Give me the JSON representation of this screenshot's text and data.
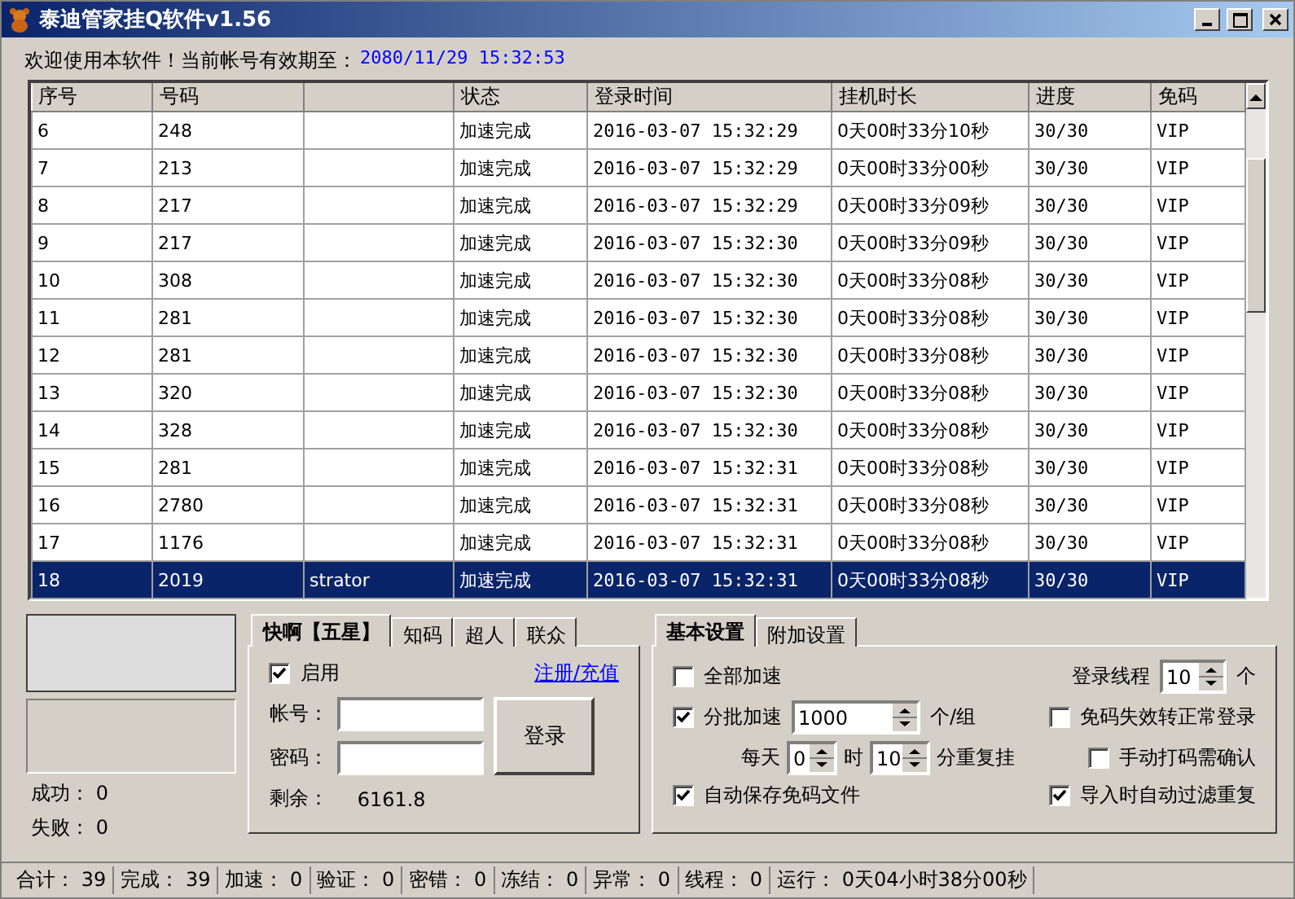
{
  "window": {
    "title": "泰迪管家挂Q软件v1.56"
  },
  "header": {
    "welcome": "欢迎使用本软件！当前帐号有效期至：",
    "expiry": "2080/11/29 15:32:53"
  },
  "table": {
    "columns": [
      "序号",
      "号码",
      "",
      "状态",
      "登录时间",
      "挂机时长",
      "进度",
      "免码"
    ],
    "rows": [
      {
        "cells": [
          "6",
          "248",
          "",
          "加速完成",
          "2016-03-07 15:32:29",
          "0天00时33分10秒",
          "30/30",
          "VIP"
        ],
        "selected": false
      },
      {
        "cells": [
          "7",
          "213",
          "",
          "加速完成",
          "2016-03-07 15:32:29",
          "0天00时33分00秒",
          "30/30",
          "VIP"
        ],
        "selected": false
      },
      {
        "cells": [
          "8",
          "217",
          "",
          "加速完成",
          "2016-03-07 15:32:29",
          "0天00时33分09秒",
          "30/30",
          "VIP"
        ],
        "selected": false
      },
      {
        "cells": [
          "9",
          "217",
          "",
          "加速完成",
          "2016-03-07 15:32:30",
          "0天00时33分09秒",
          "30/30",
          "VIP"
        ],
        "selected": false
      },
      {
        "cells": [
          "10",
          "308",
          "",
          "加速完成",
          "2016-03-07 15:32:30",
          "0天00时33分08秒",
          "30/30",
          "VIP"
        ],
        "selected": false
      },
      {
        "cells": [
          "11",
          "281",
          "",
          "加速完成",
          "2016-03-07 15:32:30",
          "0天00时33分08秒",
          "30/30",
          "VIP"
        ],
        "selected": false
      },
      {
        "cells": [
          "12",
          "281",
          "",
          "加速完成",
          "2016-03-07 15:32:30",
          "0天00时33分08秒",
          "30/30",
          "VIP"
        ],
        "selected": false
      },
      {
        "cells": [
          "13",
          "320",
          "",
          "加速完成",
          "2016-03-07 15:32:30",
          "0天00时33分08秒",
          "30/30",
          "VIP"
        ],
        "selected": false
      },
      {
        "cells": [
          "14",
          "328",
          "",
          "加速完成",
          "2016-03-07 15:32:30",
          "0天00时33分08秒",
          "30/30",
          "VIP"
        ],
        "selected": false
      },
      {
        "cells": [
          "15",
          "281",
          "",
          "加速完成",
          "2016-03-07 15:32:31",
          "0天00时33分08秒",
          "30/30",
          "VIP"
        ],
        "selected": false
      },
      {
        "cells": [
          "16",
          "2780",
          "",
          "加速完成",
          "2016-03-07 15:32:31",
          "0天00时33分08秒",
          "30/30",
          "VIP"
        ],
        "selected": false
      },
      {
        "cells": [
          "17",
          "1176",
          "",
          "加速完成",
          "2016-03-07 15:32:31",
          "0天00时33分08秒",
          "30/30",
          "VIP"
        ],
        "selected": false
      },
      {
        "cells": [
          "18",
          "2019",
          "strator",
          "加速完成",
          "2016-03-07 15:32:31",
          "0天00时33分08秒",
          "30/30",
          "VIP"
        ],
        "selected": true
      }
    ]
  },
  "results": [
    {
      "label": "成功：",
      "value": "0"
    },
    {
      "label": "失败：",
      "value": "0"
    }
  ],
  "account_tabs": [
    {
      "label": "快啊【五星】",
      "selected": true
    },
    {
      "label": "知码",
      "selected": false
    },
    {
      "label": "超人",
      "selected": false
    },
    {
      "label": "联众",
      "selected": false
    }
  ],
  "account": {
    "enable": {
      "label": "启用",
      "checked": true
    },
    "link": "注册/充值",
    "fields": [
      {
        "label": "帐号："
      },
      {
        "label": "密码："
      }
    ],
    "login_button": "登录",
    "balance_label": "剩余：",
    "balance": "6161.8"
  },
  "settings_tabs": [
    {
      "label": "基本设置",
      "selected": true
    },
    {
      "label": "附加设置",
      "selected": false
    }
  ],
  "settings": {
    "all_speed": {
      "label": "全部加速",
      "checked": false
    },
    "batch": {
      "label": "分批加速",
      "checked": true,
      "value": "1000",
      "unit": "个/组"
    },
    "daily": {
      "label": "每天",
      "hours": "0",
      "hours_unit": "时",
      "minutes": "10",
      "suffix": "分重复挂"
    },
    "autosave": {
      "label": "自动保存免码文件",
      "checked": true
    },
    "threads": {
      "label": "登录线程",
      "value": "10",
      "unit": "个"
    },
    "options": [
      {
        "label": "免码失效转正常登录",
        "checked": false
      },
      {
        "label": "手动打码需确认",
        "checked": false
      },
      {
        "label": "导入时自动过滤重复",
        "checked": true
      }
    ]
  },
  "status_bar": [
    {
      "label": "合计：",
      "value": "39"
    },
    {
      "label": "完成：",
      "value": "39"
    },
    {
      "label": "加速：",
      "value": "0"
    },
    {
      "label": "验证：",
      "value": "0"
    },
    {
      "label": "密错：",
      "value": "0"
    },
    {
      "label": "冻结：",
      "value": "0"
    },
    {
      "label": "异常：",
      "value": "0"
    },
    {
      "label": "线程：",
      "value": "0"
    },
    {
      "label": "运行：",
      "value": "0天04小时38分00秒"
    }
  ]
}
